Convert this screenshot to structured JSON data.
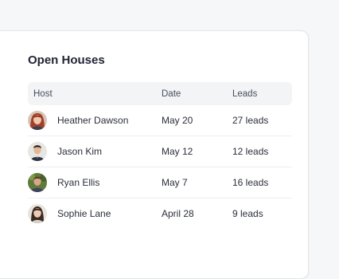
{
  "card": {
    "title": "Open Houses"
  },
  "table": {
    "columns": {
      "host": "Host",
      "date": "Date",
      "leads": "Leads"
    },
    "rows": [
      {
        "host": "Heather Dawson",
        "date": "May 20",
        "leads": "27 leads",
        "avatar_icon": "avatar-woman-red-hair"
      },
      {
        "host": "Jason Kim",
        "date": "May 12",
        "leads": "12 leads",
        "avatar_icon": "avatar-man-suit"
      },
      {
        "host": "Ryan Ellis",
        "date": "May 7",
        "leads": "16 leads",
        "avatar_icon": "avatar-man-outdoor"
      },
      {
        "host": "Sophie Lane",
        "date": "April 28",
        "leads": "9 leads",
        "avatar_icon": "avatar-woman-dark-hair"
      }
    ]
  },
  "colors": {
    "page_bg": "#f6f7f9",
    "card_bg": "#ffffff",
    "header_bg": "#f3f4f6",
    "text_primary": "#1f2333",
    "divider": "#eceef1"
  }
}
